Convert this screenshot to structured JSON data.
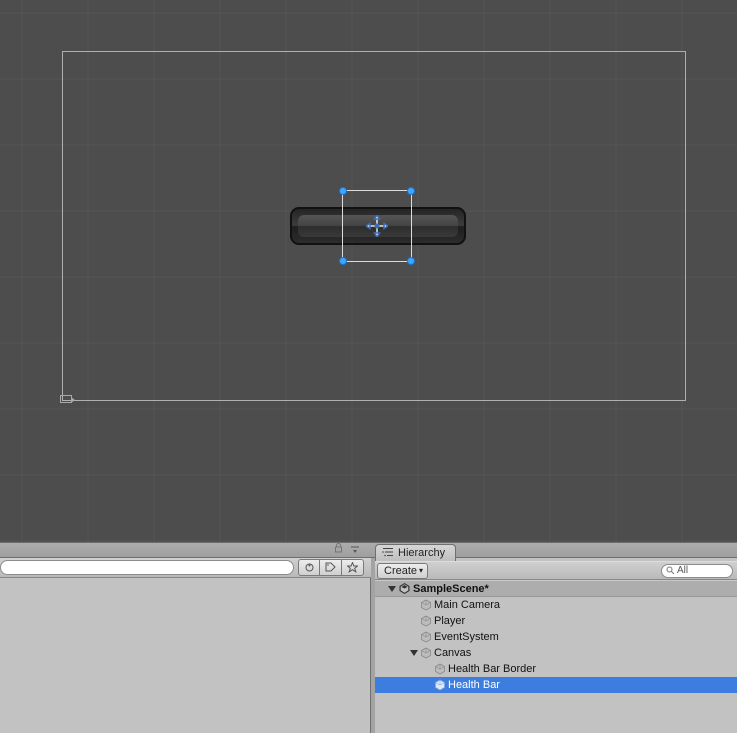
{
  "hierarchy": {
    "tab_label": "Hierarchy",
    "create_label": "Create",
    "search_placeholder": "All",
    "scene_name": "SampleScene*",
    "items": [
      {
        "label": "Main Camera",
        "indent": 1
      },
      {
        "label": "Player",
        "indent": 1
      },
      {
        "label": "EventSystem",
        "indent": 1
      },
      {
        "label": "Canvas",
        "indent": 1,
        "expanded": true
      },
      {
        "label": "Health Bar Border",
        "indent": 2
      },
      {
        "label": "Health Bar",
        "indent": 2,
        "selected": true
      }
    ]
  }
}
